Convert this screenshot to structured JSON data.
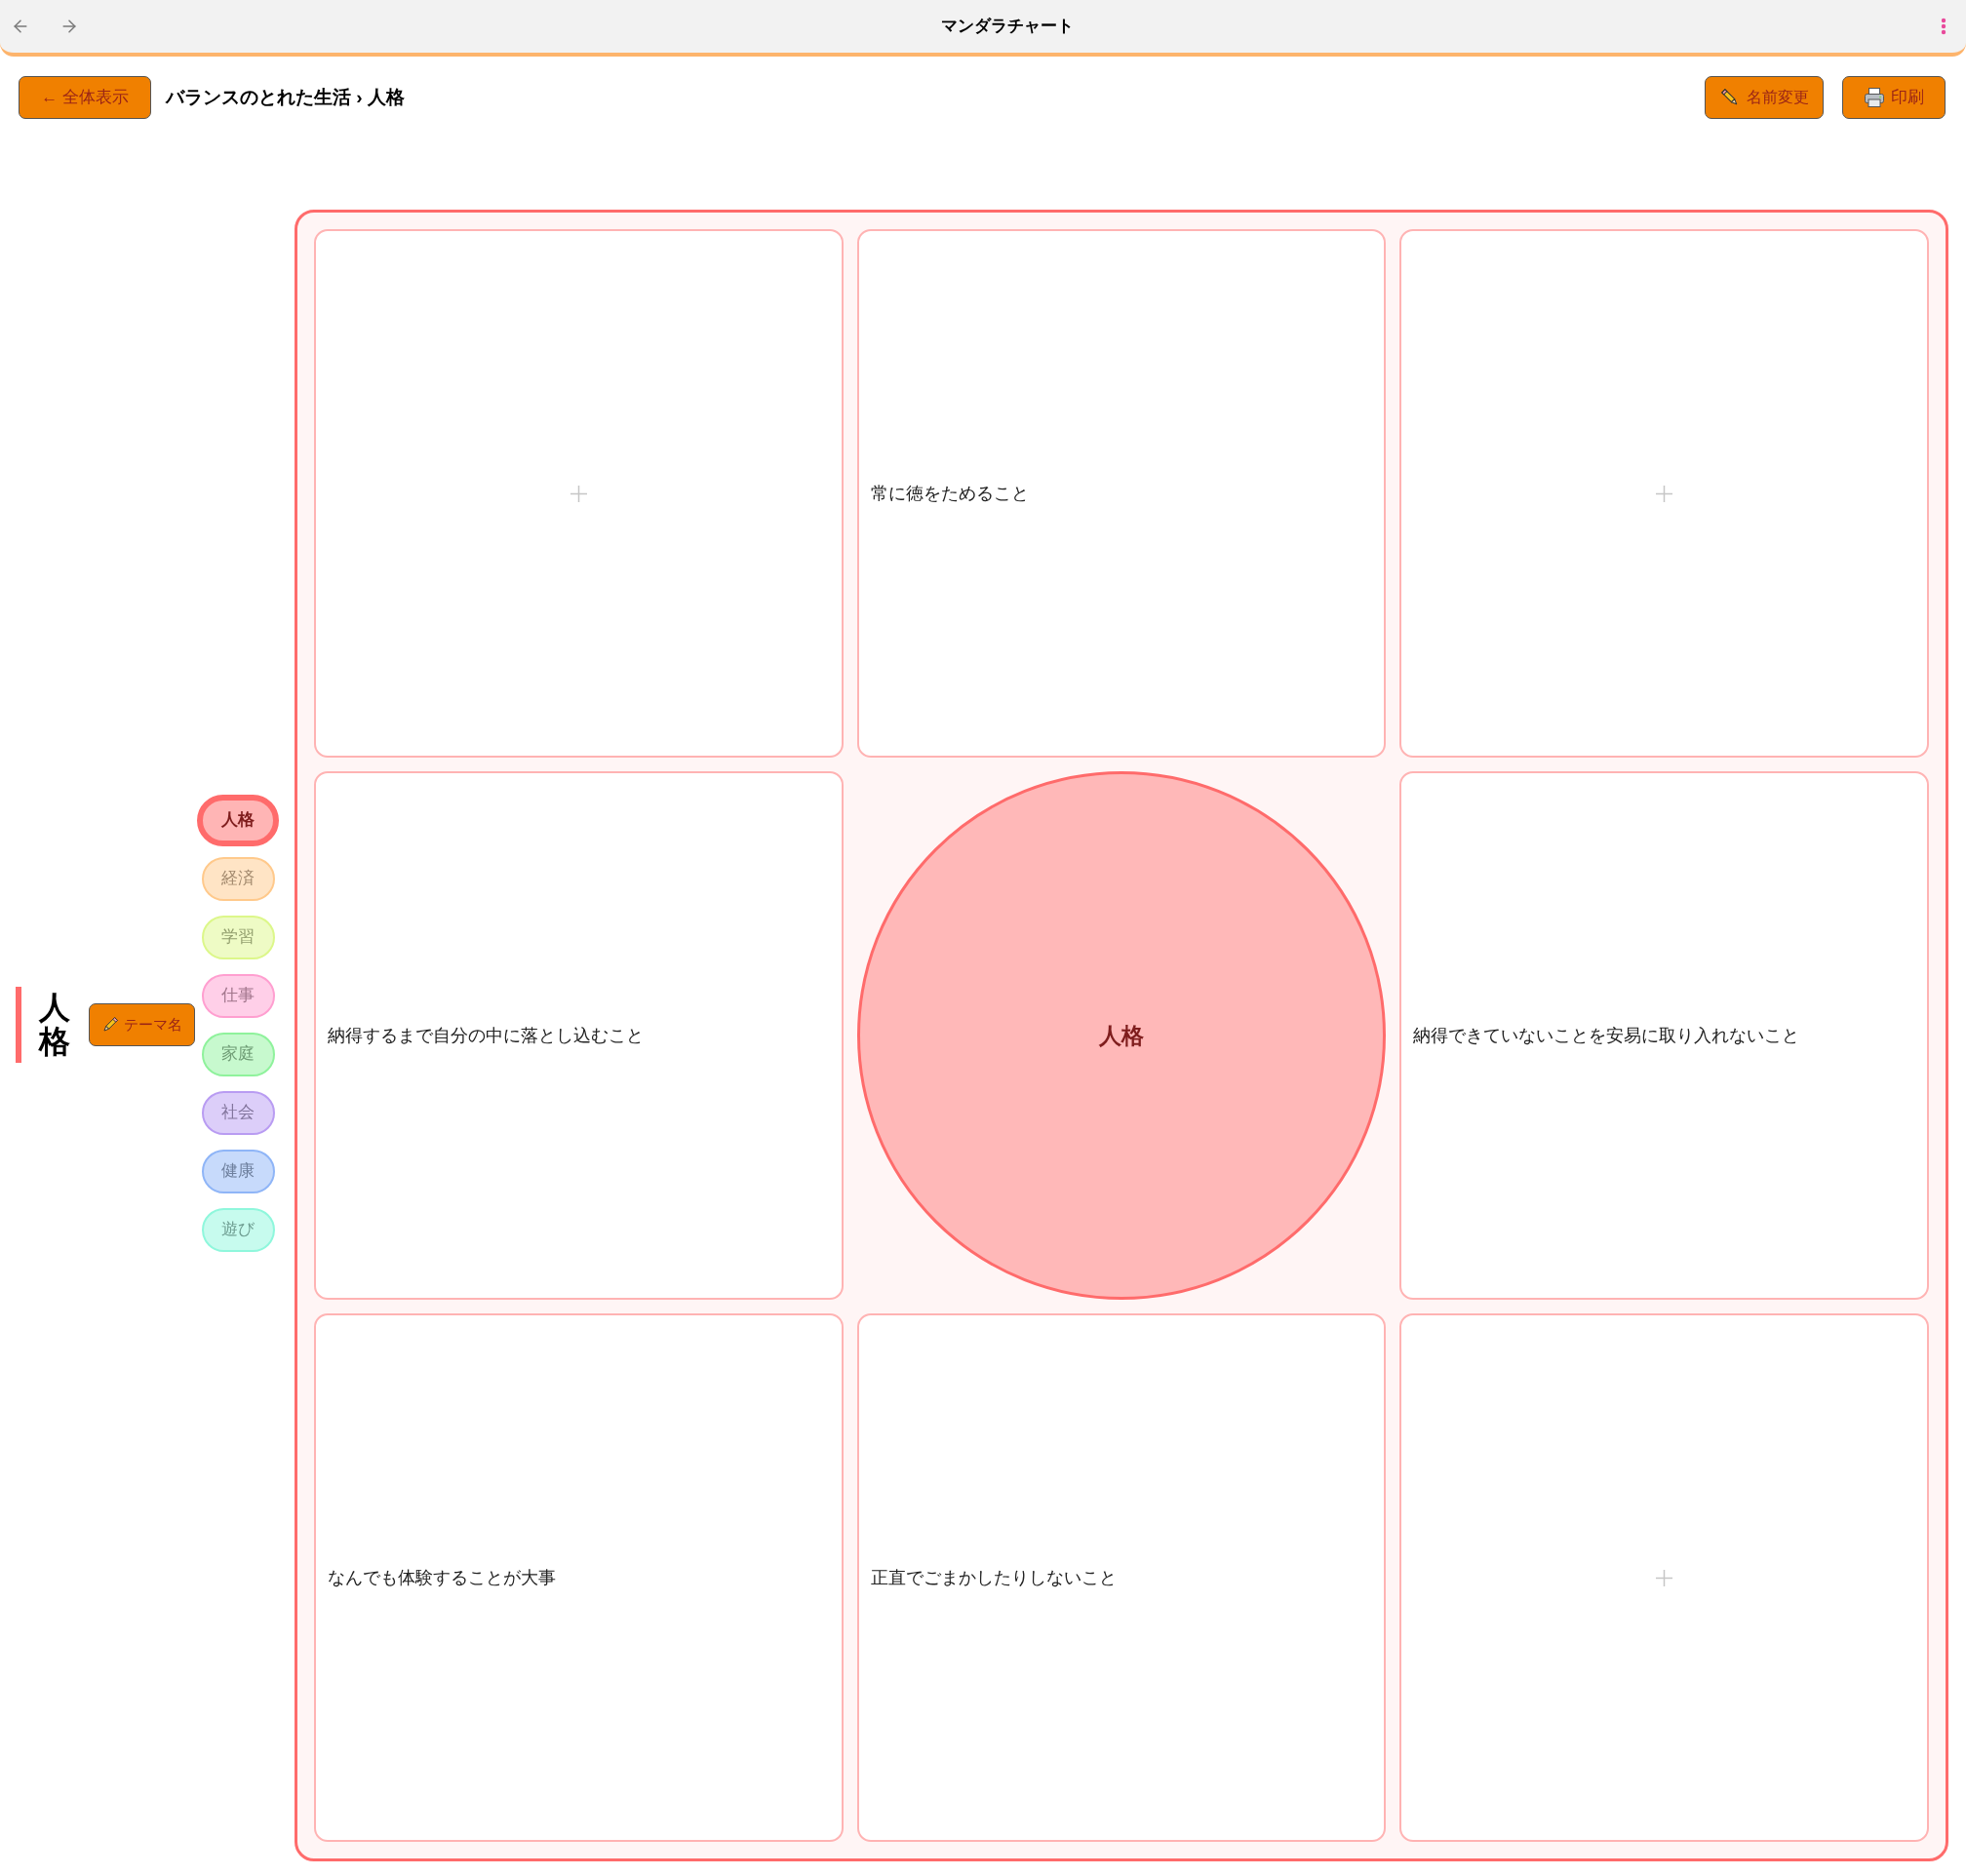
{
  "window": {
    "title": "マンダラチャート"
  },
  "toolbar": {
    "back_button": "← 全体表示",
    "breadcrumb": "バランスのとれた生活 › 人格",
    "rename_button": "名前変更",
    "print_button": "印刷"
  },
  "sidebar": {
    "theme_title": "人格",
    "theme_name_button": "テーマ名",
    "categories": [
      {
        "label": "人格",
        "color": "#ff6b6b",
        "selected": true
      },
      {
        "label": "経済",
        "color": "#ffc98b",
        "selected": false
      },
      {
        "label": "学習",
        "color": "#dcf78a",
        "selected": false
      },
      {
        "label": "仕事",
        "color": "#ff9fd0",
        "selected": false
      },
      {
        "label": "家庭",
        "color": "#8ff29c",
        "selected": false
      },
      {
        "label": "社会",
        "color": "#b99cf2",
        "selected": false
      },
      {
        "label": "健康",
        "color": "#8fb5f7",
        "selected": false
      },
      {
        "label": "遊び",
        "color": "#8ff7dc",
        "selected": false
      }
    ]
  },
  "grid": {
    "cells": [
      {
        "kind": "empty"
      },
      {
        "kind": "goal",
        "text": "常に徳をためること"
      },
      {
        "kind": "empty"
      },
      {
        "kind": "goal",
        "text": "納得するまで自分の中に落とし込むこと"
      },
      {
        "kind": "center",
        "text": "人格"
      },
      {
        "kind": "goal",
        "text": "納得できていないことを安易に取り入れないこと"
      },
      {
        "kind": "goal",
        "text": "なんでも体験することが大事"
      },
      {
        "kind": "goal",
        "text": "正直でごまかしたりしないこと"
      },
      {
        "kind": "empty"
      }
    ]
  }
}
